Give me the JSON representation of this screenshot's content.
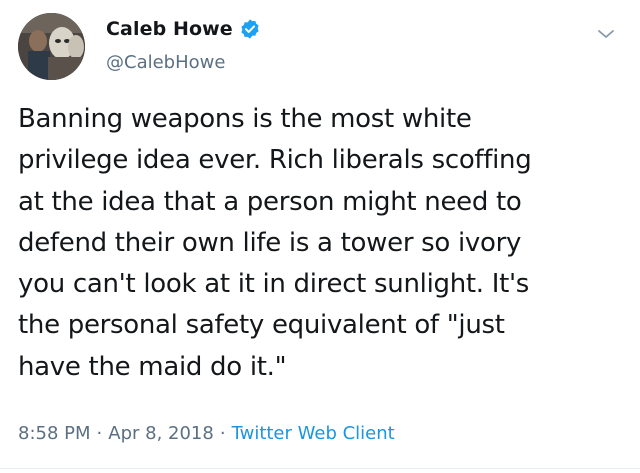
{
  "tweet": {
    "author": {
      "display_name": "Caleb Howe",
      "handle": "@CalebHowe",
      "verified": true
    },
    "text": "Banning weapons is the most white\nprivilege idea ever. Rich liberals scoffing\nat the idea that a person might need to\ndefend their own life is a tower so ivory\nyou can't look at it in direct sunlight. It's\nthe personal safety equivalent of \"just\nhave the maid do it.\"",
    "time": "8:58 PM",
    "separator": "·",
    "date": "Apr 8, 2018",
    "client": "Twitter Web Client"
  },
  "icons": {
    "verified": "verified-badge-icon",
    "menu": "chevron-down-icon"
  },
  "colors": {
    "text_primary": "#14171a",
    "text_secondary": "#5b7083",
    "link": "#1b95e0",
    "verified": "#1da1f2"
  }
}
